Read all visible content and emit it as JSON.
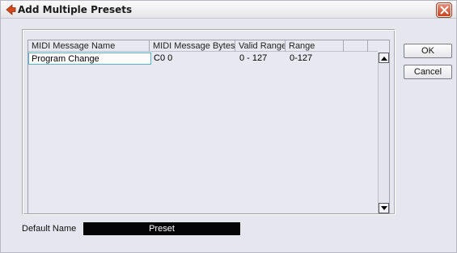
{
  "window": {
    "title": "Add Multiple Presets",
    "accent": "#c8421f"
  },
  "table": {
    "columns": [
      "MIDI Message Name",
      "MIDI Message Bytes",
      "Valid Range",
      "Range"
    ],
    "rows": [
      [
        "Program Change",
        "C0 0",
        "0 - 127",
        "0-127"
      ]
    ]
  },
  "buttons": {
    "ok": "OK",
    "cancel": "Cancel"
  },
  "default_name": {
    "label": "Default Name",
    "value": "Preset"
  },
  "icons": {
    "title": "cubase-arrow-icon",
    "close": "close-icon",
    "scroll_up": "arrow-up-icon",
    "scroll_down": "arrow-down-icon"
  }
}
